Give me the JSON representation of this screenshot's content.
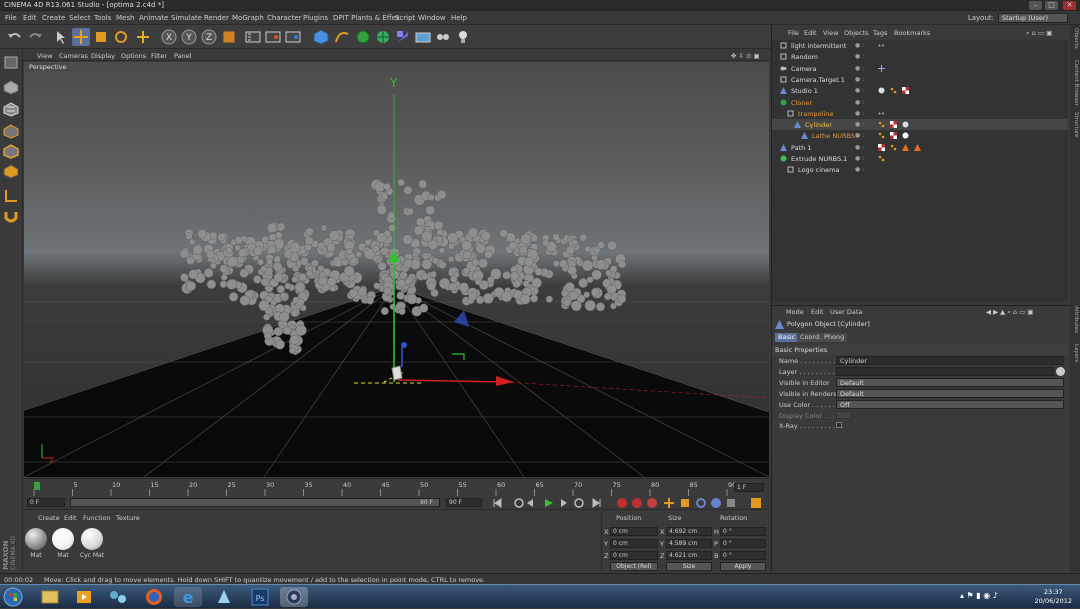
{
  "window": {
    "title": "CINEMA 4D R13.061 Studio - [optima 2.c4d *]"
  },
  "menubar": {
    "items": [
      "File",
      "Edit",
      "Create",
      "Select",
      "Tools",
      "Mesh",
      "Animate",
      "Simulate",
      "Render",
      "MoGraph",
      "Character",
      "Plugins",
      "DPIT Plants & Effex",
      "Script",
      "Window",
      "Help"
    ],
    "layout_label": "Layout:",
    "layout_value": "Startup (User)"
  },
  "viewport": {
    "menu": [
      "View",
      "Cameras",
      "Display",
      "Options",
      "Filter",
      "Panel"
    ],
    "label": "Perspective",
    "axis_y": "Y",
    "axis_x": "x"
  },
  "timeline": {
    "ticks": [
      "0",
      "5",
      "10",
      "15",
      "20",
      "25",
      "30",
      "35",
      "40",
      "45",
      "50",
      "55",
      "60",
      "65",
      "70",
      "75",
      "80",
      "85",
      "90"
    ],
    "end_frame": "1 F",
    "current_frame": "0 F",
    "start_field": "0 F",
    "range_end": "90 F",
    "max_field": "90 F"
  },
  "materials": {
    "menu": [
      "Create",
      "Edit",
      "Function",
      "Texture"
    ],
    "items": [
      {
        "label": "Mat",
        "color": "#b0b0b0"
      },
      {
        "label": "Mat",
        "color": "#f2f2f2"
      },
      {
        "label": "Cyc Mat",
        "color": "#d8d8d8"
      }
    ],
    "brand_1": "MAXON",
    "brand_2": "CINEMA 4D"
  },
  "coords": {
    "headers": [
      "Position",
      "Size",
      "Rotation"
    ],
    "rows": [
      {
        "axis": "X",
        "pos": "0 cm",
        "size_axis": "X",
        "size": "4.692 cm",
        "rot_axis": "H",
        "rot": "0 °"
      },
      {
        "axis": "Y",
        "pos": "0 cm",
        "size_axis": "Y",
        "size": "4.589 cm",
        "rot_axis": "P",
        "rot": "0 °"
      },
      {
        "axis": "Z",
        "pos": "0 cm",
        "size_axis": "Z",
        "size": "4.621 cm",
        "rot_axis": "B",
        "rot": "0 °"
      }
    ],
    "mode_select": "Object (Rel)",
    "size_select": "Size",
    "apply_label": "Apply"
  },
  "object_manager": {
    "menu": [
      "File",
      "Edit",
      "View",
      "Objects",
      "Tags",
      "Bookmarks"
    ],
    "objects": [
      {
        "name": "light intermittent",
        "indent": 0,
        "color": "#dddddd",
        "icon": "null",
        "tags": [
          "dots"
        ]
      },
      {
        "name": "Random",
        "indent": 0,
        "color": "#dddddd",
        "icon": "null",
        "tags": []
      },
      {
        "name": "Camera",
        "indent": 0,
        "color": "#dddddd",
        "icon": "camera",
        "tags": [
          "target"
        ]
      },
      {
        "name": "Camera.Target.1",
        "indent": 0,
        "color": "#dddddd",
        "icon": "null",
        "tags": []
      },
      {
        "name": "Studio 1",
        "indent": 0,
        "color": "#dddddd",
        "icon": "poly",
        "tags": [
          "sphere",
          "orange",
          "checker"
        ]
      },
      {
        "name": "Cloner",
        "indent": 0,
        "color": "#e09a3a",
        "icon": "cloner",
        "tags": []
      },
      {
        "name": "trampoline",
        "indent": 1,
        "color": "#e09a3a",
        "icon": "null",
        "tags": [
          "dots"
        ]
      },
      {
        "name": "Cylinder",
        "indent": 2,
        "color": "#f0c040",
        "icon": "poly",
        "tags": [
          "orange",
          "checker",
          "sphere"
        ]
      },
      {
        "name": "Lathe NURBS",
        "indent": 3,
        "color": "#e09a3a",
        "icon": "poly",
        "tags": [
          "orange",
          "checker",
          "white"
        ]
      },
      {
        "name": "Path 1",
        "indent": 0,
        "color": "#dddddd",
        "icon": "poly",
        "tags": [
          "checker",
          "orange",
          "tri",
          "tri"
        ]
      },
      {
        "name": "Extrude NURBS.1",
        "indent": 0,
        "color": "#dddddd",
        "icon": "green",
        "tags": [
          "orange"
        ]
      },
      {
        "name": "Logo cinema",
        "indent": 1,
        "color": "#dddddd",
        "icon": "null",
        "tags": []
      }
    ]
  },
  "attributes": {
    "menu": [
      "Mode",
      "Edit",
      "User Data"
    ],
    "title": "Polygon Object [Cylinder]",
    "tabs": [
      "Basic",
      "Coord.",
      "Phong"
    ],
    "section": "Basic Properties",
    "fields": [
      {
        "label": "Name . . . . . . . . . . .",
        "value": "Cylinder",
        "kind": "text"
      },
      {
        "label": "Layer . . . . . . . . . . .",
        "value": "",
        "kind": "text"
      },
      {
        "label": "Visible in Editor",
        "value": "Default",
        "kind": "select"
      },
      {
        "label": "Visible in Renderer",
        "value": "Default",
        "kind": "select"
      },
      {
        "label": "Use Color . . . . . . .",
        "value": "Off",
        "kind": "select"
      },
      {
        "label": "Display Color . . .",
        "value": "",
        "kind": "disabled"
      },
      {
        "label": "X-Ray . . . . . . . . . . .",
        "value": "",
        "kind": "check"
      }
    ]
  },
  "side_tabs": [
    "Objects",
    "Content Browser",
    "Structure",
    "Attributes",
    "Layers"
  ],
  "status": {
    "time": "00:00:02",
    "message": "Move: Click and drag to move elements. Hold down SHIFT to quantize movement / add to the selection in point mode, CTRL to remove."
  },
  "taskbar": {
    "apps": [
      "start",
      "explorer",
      "media",
      "network",
      "firefox",
      "ie",
      "tablet",
      "photoshop",
      "cinema4d"
    ],
    "time": "23:37",
    "date": "20/06/2012"
  },
  "colors": {
    "accent": "#e09a3a",
    "selected_tab": "#5a6f99",
    "axis_x": "#d02020",
    "axis_y": "#30c030",
    "axis_z": "#3050d0"
  }
}
